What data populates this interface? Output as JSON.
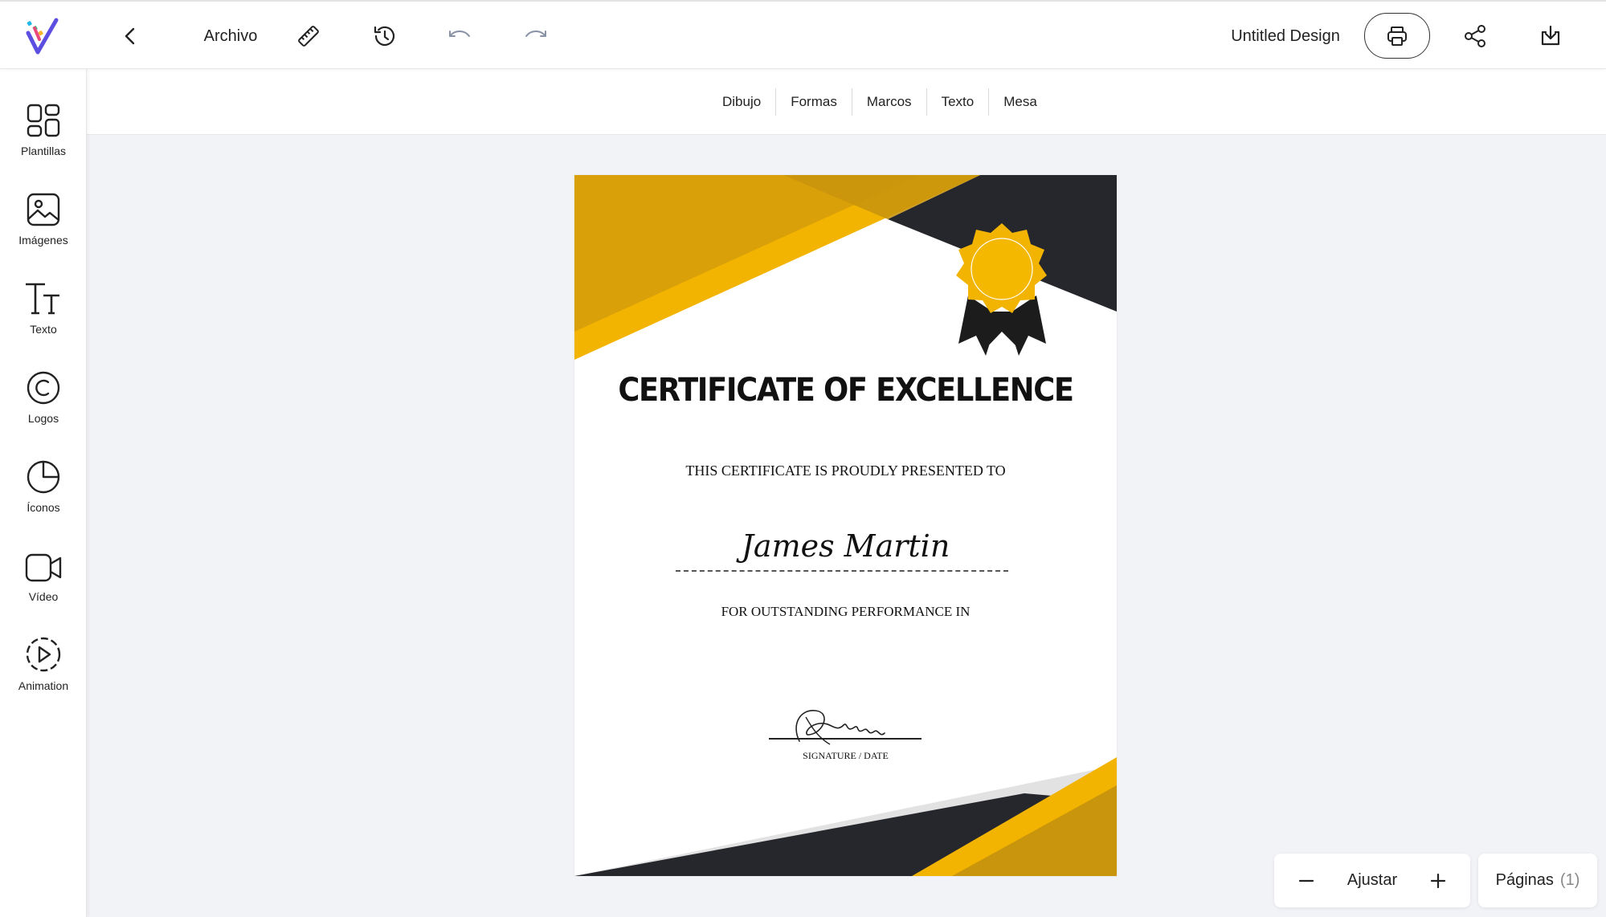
{
  "header": {
    "file_menu": "Archivo",
    "document_title": "Untitled Design"
  },
  "sidebar": {
    "items": [
      {
        "label": "Plantillas",
        "icon": "templates-icon"
      },
      {
        "label": "Imágenes",
        "icon": "image-icon"
      },
      {
        "label": "Texto",
        "icon": "text-icon"
      },
      {
        "label": "Logos",
        "icon": "copyright-icon"
      },
      {
        "label": "Íconos",
        "icon": "sticker-icon"
      },
      {
        "label": "Vídeo",
        "icon": "video-icon"
      },
      {
        "label": "Animation",
        "icon": "play-circle-icon"
      }
    ]
  },
  "subtoolbar": {
    "tabs": [
      "Dibujo",
      "Formas",
      "Marcos",
      "Texto",
      "Mesa"
    ]
  },
  "certificate": {
    "title": "CERTIFICATE OF EXCELLENCE",
    "presented": "THIS CERTIFICATE IS PROUDLY PRESENTED TO",
    "name": "James Martin",
    "for": "FOR OUTSTANDING PERFORMANCE IN",
    "signature_label": "SIGNATURE / DATE",
    "colors": {
      "gold": "#f2b400",
      "gold_dark": "#c9950c",
      "dark": "#26272c"
    }
  },
  "zoom": {
    "label": "Ajustar"
  },
  "pages": {
    "label": "Páginas",
    "count": "(1)"
  }
}
